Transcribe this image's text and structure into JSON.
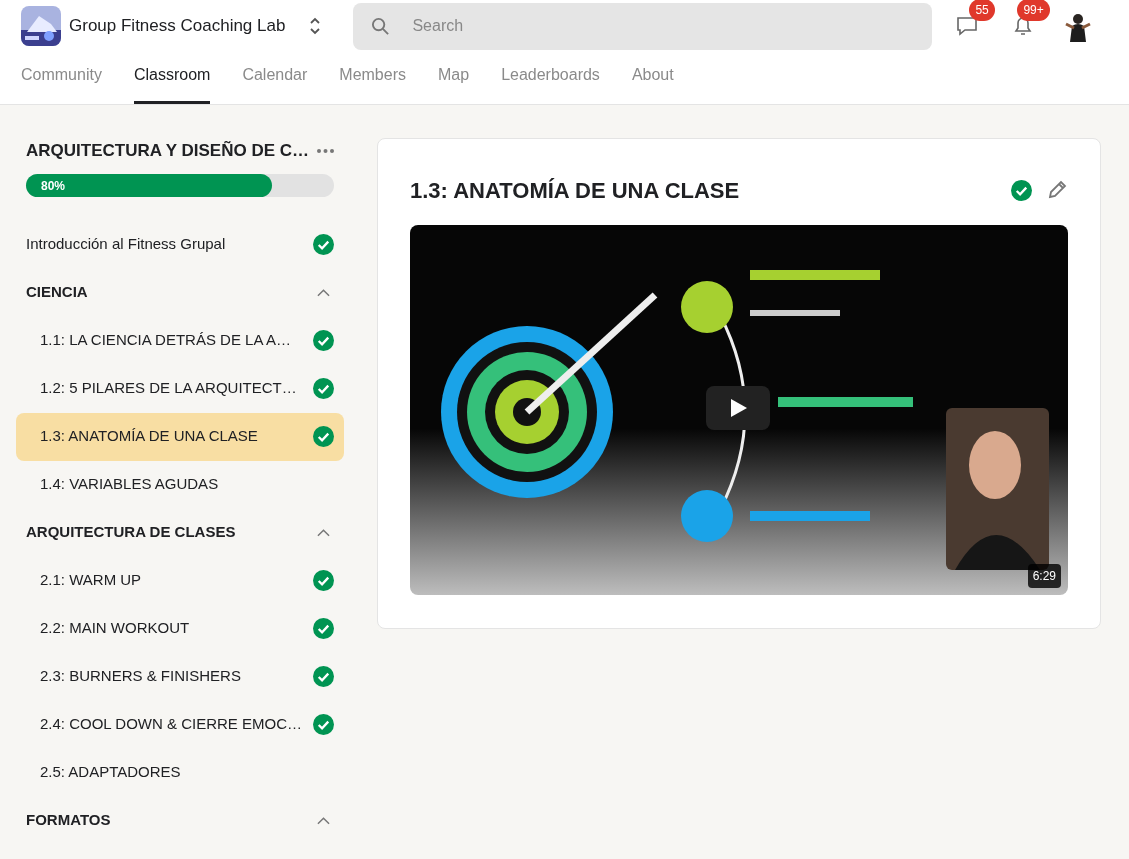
{
  "header": {
    "group_name": "Group Fitness Coaching Lab",
    "search": {
      "placeholder": "Search"
    },
    "chat_badge": "55",
    "notifications_badge": "99+"
  },
  "tabs": [
    {
      "label": "Community",
      "selected": false
    },
    {
      "label": "Classroom",
      "selected": true
    },
    {
      "label": "Calendar",
      "selected": false
    },
    {
      "label": "Members",
      "selected": false
    },
    {
      "label": "Map",
      "selected": false
    },
    {
      "label": "Leaderboards",
      "selected": false
    },
    {
      "label": "About",
      "selected": false
    }
  ],
  "course": {
    "title": "ARQUITECTURA Y DISEÑO DE C…",
    "progress": {
      "level": 0.8,
      "label": "80%"
    },
    "items": [
      {
        "kind": "lesson",
        "title": "Introducción al Fitness Grupal",
        "completed": true,
        "selected": false
      },
      {
        "kind": "section",
        "title": "CIENCIA",
        "expanded": true,
        "children": [
          {
            "kind": "lesson",
            "title": "1.1: LA CIENCIA DETRÁS DE LA A…",
            "completed": true,
            "selected": false
          },
          {
            "kind": "lesson",
            "title": "1.2: 5 PILARES DE LA ARQUITECT…",
            "completed": true,
            "selected": false
          },
          {
            "kind": "lesson",
            "title": "1.3: ANATOMÍA DE UNA CLASE",
            "completed": true,
            "selected": true
          },
          {
            "kind": "lesson",
            "title": "1.4: VARIABLES AGUDAS",
            "completed": false,
            "selected": false
          }
        ]
      },
      {
        "kind": "section",
        "title": "ARQUITECTURA DE CLASES",
        "expanded": true,
        "children": [
          {
            "kind": "lesson",
            "title": "2.1: WARM UP",
            "completed": true,
            "selected": false
          },
          {
            "kind": "lesson",
            "title": "2.2: MAIN WORKOUT",
            "completed": true,
            "selected": false
          },
          {
            "kind": "lesson",
            "title": "2.3: BURNERS & FINISHERS",
            "completed": true,
            "selected": false
          },
          {
            "kind": "lesson",
            "title": "2.4: COOL DOWN & CIERRE EMOC…",
            "completed": true,
            "selected": false
          },
          {
            "kind": "lesson",
            "title": "2.5: ADAPTADORES",
            "completed": false,
            "selected": false
          }
        ]
      },
      {
        "kind": "section",
        "title": "FORMATOS",
        "expanded": true
      }
    ]
  },
  "lesson": {
    "title": "1.3: ANATOMÍA DE UNA CLASE",
    "completed": true,
    "video": {
      "duration": "6:29"
    }
  }
}
